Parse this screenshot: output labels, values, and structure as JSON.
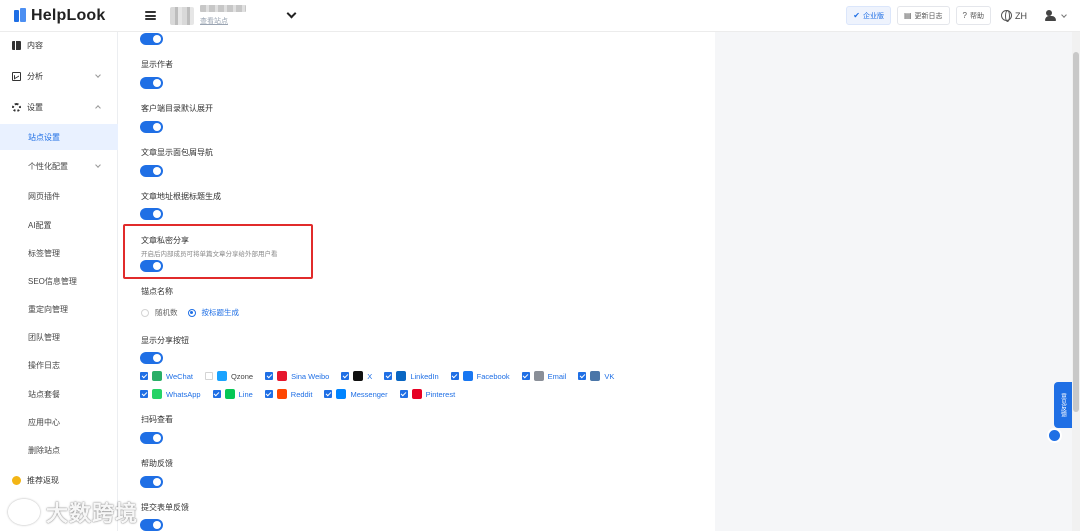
{
  "header": {
    "logo_text": "HelpLook",
    "site_link": "查看站点",
    "buttons": {
      "enterprise": "企业版",
      "changelog": "更新日志",
      "help": "帮助"
    },
    "lang": "ZH"
  },
  "sidebar": {
    "content": "内容",
    "analytics": "分析",
    "settings": "设置",
    "site_settings": "站点设置",
    "personalization": "个性化配置",
    "web_plugin": "网页插件",
    "ai_config": "AI配置",
    "tag_mgmt": "标签管理",
    "seo": "SEO信息管理",
    "redirect": "重定向管理",
    "team": "团队管理",
    "ops_log": "操作日志",
    "plan": "站点套餐",
    "apps": "应用中心",
    "delete_site": "删除站点",
    "referral": "推荐返现"
  },
  "settings": {
    "show_author": "显示作者",
    "client_toc_expand": "客户端目录默认展开",
    "show_breadcrumb": "文章显示面包屑导航",
    "url_from_title": "文章地址根据标题生成",
    "private_share": "文章私密分享",
    "private_share_desc": "开启后内部成员可将单篇文章分享给外部用户看",
    "anchor_name": "锚点名称",
    "anchor_random": "随机数",
    "anchor_by_title": "按标题生成",
    "show_share": "显示分享按钮",
    "scan_view": "扫码查看",
    "help_feedback": "帮助反馈",
    "form_feedback": "提交表单反馈"
  },
  "share": {
    "row1": [
      {
        "label": "WeChat",
        "checked": true,
        "color": "#2aae67",
        "icon": "wechat-icon"
      },
      {
        "label": "Qzone",
        "checked": false,
        "color": "#1aa3ff",
        "icon": "qzone-icon"
      },
      {
        "label": "Sina Weibo",
        "checked": true,
        "color": "#e6162d",
        "icon": "weibo-icon"
      },
      {
        "label": "X",
        "checked": true,
        "color": "#111111",
        "icon": "x-icon"
      },
      {
        "label": "LinkedIn",
        "checked": true,
        "color": "#0a66c2",
        "icon": "linkedin-icon"
      },
      {
        "label": "Facebook",
        "checked": true,
        "color": "#1877f2",
        "icon": "facebook-icon"
      },
      {
        "label": "Email",
        "checked": true,
        "color": "#8a8f98",
        "icon": "email-icon"
      },
      {
        "label": "VK",
        "checked": true,
        "color": "#4a76a8",
        "icon": "vk-icon"
      }
    ],
    "row2": [
      {
        "label": "WhatsApp",
        "checked": true,
        "color": "#25d366",
        "icon": "whatsapp-icon"
      },
      {
        "label": "Line",
        "checked": true,
        "color": "#06c755",
        "icon": "line-icon"
      },
      {
        "label": "Reddit",
        "checked": true,
        "color": "#ff4500",
        "icon": "reddit-icon"
      },
      {
        "label": "Messenger",
        "checked": true,
        "color": "#0084ff",
        "icon": "messenger-icon"
      },
      {
        "label": "Pinterest",
        "checked": true,
        "color": "#e60023",
        "icon": "pinterest-icon"
      }
    ]
  },
  "feedback_tab": "意见反馈",
  "watermark": "大数跨境",
  "colors": {
    "accent": "#1f6fe5",
    "highlight": "#e12b2b"
  }
}
